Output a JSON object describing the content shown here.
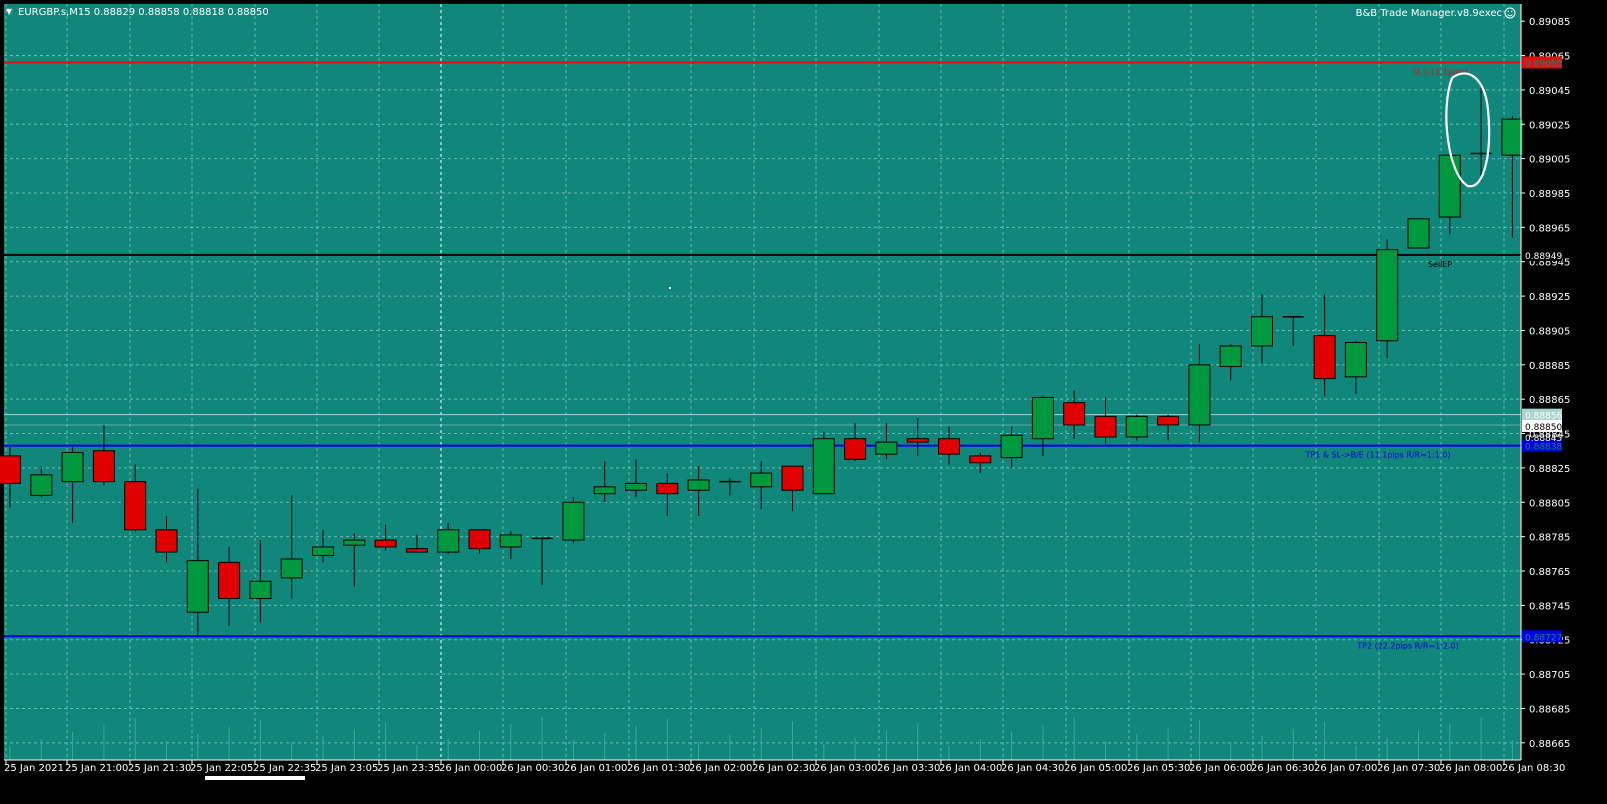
{
  "header": {
    "symbol_line": "EURGBP.s,M15  0.88829 0.88858 0.88818 0.88850",
    "ea_label": "B&B Trade Manager.v8.9exec",
    "ea_icon": "smiley-icon"
  },
  "colors": {
    "background": "#10877A",
    "grid": "#6BB8AE",
    "bull": "#00983E",
    "bear": "#E00000",
    "wick": "#000000",
    "sl_line": "#E01010",
    "entry_line": "#000000",
    "tp_line": "#0000E0",
    "price_line": "#A8D4CE",
    "annotation": "#FFFFFF"
  },
  "chart_data": {
    "type": "candlestick",
    "ylim": [
      0.88655,
      0.89095
    ],
    "y_ticks": [
      "0.89065",
      "0.89045",
      "0.89025",
      "0.89005",
      "0.88985",
      "0.88965",
      "0.88945",
      "0.88925",
      "0.88905",
      "0.88885",
      "0.88865",
      "0.88845",
      "0.88825",
      "0.88805",
      "0.88785",
      "0.88765",
      "0.88745",
      "0.88725",
      "0.88705",
      "0.88685",
      "0.88665"
    ],
    "y_extra_ticks": [
      "0.89085"
    ],
    "x_labels": [
      "25 Jan 2021",
      "25 Jan 21:00",
      "25 Jan 21:30",
      "25 Jan 22:05",
      "25 Jan 22:35",
      "25 Jan 23:05",
      "25 Jan 23:35",
      "26 Jan 00:00",
      "26 Jan 00:30",
      "26 Jan 01:00",
      "26 Jan 01:30",
      "26 Jan 02:00",
      "26 Jan 02:30",
      "26 Jan 03:00",
      "26 Jan 03:30",
      "26 Jan 04:00",
      "26 Jan 04:30",
      "26 Jan 05:00",
      "26 Jan 05:30",
      "26 Jan 06:00",
      "26 Jan 06:30",
      "26 Jan 07:00",
      "26 Jan 07:30",
      "26 Jan 08:00",
      "26 Jan 08:30"
    ],
    "candles": [
      {
        "o": 0.88832,
        "h": 0.88837,
        "l": 0.88802,
        "c": 0.88816
      },
      {
        "o": 0.88809,
        "h": 0.88826,
        "l": 0.88808,
        "c": 0.88821
      },
      {
        "o": 0.88817,
        "h": 0.88837,
        "l": 0.88793,
        "c": 0.88834
      },
      {
        "o": 0.88835,
        "h": 0.8885,
        "l": 0.88815,
        "c": 0.88817
      },
      {
        "o": 0.88817,
        "h": 0.88827,
        "l": 0.88788,
        "c": 0.88789
      },
      {
        "o": 0.88789,
        "h": 0.88797,
        "l": 0.8877,
        "c": 0.88776
      },
      {
        "o": 0.88741,
        "h": 0.88813,
        "l": 0.88728,
        "c": 0.88771
      },
      {
        "o": 0.8877,
        "h": 0.88779,
        "l": 0.88733,
        "c": 0.88749
      },
      {
        "o": 0.88749,
        "h": 0.88783,
        "l": 0.88735,
        "c": 0.88759
      },
      {
        "o": 0.88761,
        "h": 0.88809,
        "l": 0.88749,
        "c": 0.88772
      },
      {
        "o": 0.88774,
        "h": 0.88789,
        "l": 0.8877,
        "c": 0.88779
      },
      {
        "o": 0.8878,
        "h": 0.88787,
        "l": 0.88756,
        "c": 0.88783
      },
      {
        "o": 0.88783,
        "h": 0.88792,
        "l": 0.88777,
        "c": 0.88779
      },
      {
        "o": 0.88778,
        "h": 0.88786,
        "l": 0.88776,
        "c": 0.88776
      },
      {
        "o": 0.88776,
        "h": 0.88793,
        "l": 0.88775,
        "c": 0.88789
      },
      {
        "o": 0.88789,
        "h": 0.88789,
        "l": 0.88775,
        "c": 0.88778
      },
      {
        "o": 0.88779,
        "h": 0.88788,
        "l": 0.88772,
        "c": 0.88786
      },
      {
        "o": 0.88784,
        "h": 0.88784,
        "l": 0.88757,
        "c": 0.88784
      },
      {
        "o": 0.88783,
        "h": 0.88808,
        "l": 0.88781,
        "c": 0.88805
      },
      {
        "o": 0.8881,
        "h": 0.88829,
        "l": 0.88805,
        "c": 0.88814
      },
      {
        "o": 0.88812,
        "h": 0.8883,
        "l": 0.88808,
        "c": 0.88816
      },
      {
        "o": 0.88816,
        "h": 0.88822,
        "l": 0.88797,
        "c": 0.8881
      },
      {
        "o": 0.88812,
        "h": 0.88826,
        "l": 0.88797,
        "c": 0.88818
      },
      {
        "o": 0.88817,
        "h": 0.88819,
        "l": 0.88809,
        "c": 0.88817
      },
      {
        "o": 0.88814,
        "h": 0.88829,
        "l": 0.88801,
        "c": 0.88822
      },
      {
        "o": 0.88826,
        "h": 0.88826,
        "l": 0.888,
        "c": 0.88812
      },
      {
        "o": 0.8881,
        "h": 0.88846,
        "l": 0.8881,
        "c": 0.88842
      },
      {
        "o": 0.88842,
        "h": 0.88851,
        "l": 0.88829,
        "c": 0.8883
      },
      {
        "o": 0.88833,
        "h": 0.88851,
        "l": 0.8883,
        "c": 0.8884
      },
      {
        "o": 0.88842,
        "h": 0.88854,
        "l": 0.88832,
        "c": 0.8884
      },
      {
        "o": 0.88842,
        "h": 0.88849,
        "l": 0.88827,
        "c": 0.88833
      },
      {
        "o": 0.88832,
        "h": 0.88834,
        "l": 0.88822,
        "c": 0.88828
      },
      {
        "o": 0.88831,
        "h": 0.88849,
        "l": 0.88825,
        "c": 0.88844
      },
      {
        "o": 0.88842,
        "h": 0.88867,
        "l": 0.88832,
        "c": 0.88866
      },
      {
        "o": 0.88863,
        "h": 0.8887,
        "l": 0.88842,
        "c": 0.8885
      },
      {
        "o": 0.88855,
        "h": 0.88866,
        "l": 0.88839,
        "c": 0.88843
      },
      {
        "o": 0.88843,
        "h": 0.88856,
        "l": 0.88841,
        "c": 0.88855
      },
      {
        "o": 0.88855,
        "h": 0.88856,
        "l": 0.88841,
        "c": 0.8885
      },
      {
        "o": 0.8885,
        "h": 0.88897,
        "l": 0.8884,
        "c": 0.88885
      },
      {
        "o": 0.88884,
        "h": 0.88897,
        "l": 0.88876,
        "c": 0.88896
      },
      {
        "o": 0.88896,
        "h": 0.88926,
        "l": 0.88886,
        "c": 0.88913
      },
      {
        "o": 0.88913,
        "h": 0.88913,
        "l": 0.88896,
        "c": 0.88913
      },
      {
        "o": 0.88902,
        "h": 0.88926,
        "l": 0.88867,
        "c": 0.88877
      },
      {
        "o": 0.88878,
        "h": 0.88899,
        "l": 0.88868,
        "c": 0.88898
      },
      {
        "o": 0.88899,
        "h": 0.88958,
        "l": 0.88889,
        "c": 0.88952
      },
      {
        "o": 0.88953,
        "h": 0.8897,
        "l": 0.88953,
        "c": 0.8897
      },
      {
        "o": 0.88971,
        "h": 0.89007,
        "l": 0.88961,
        "c": 0.89007
      },
      {
        "o": 0.89008,
        "h": 0.89046,
        "l": 0.88992,
        "c": 0.89008
      },
      {
        "o": 0.89007,
        "h": 0.8903,
        "l": 0.88959,
        "c": 0.89028
      }
    ],
    "levels": [
      {
        "price": 0.89061,
        "tag": "0.89060",
        "label": "SL (-11.1pips)",
        "kind": "sl"
      },
      {
        "price": 0.88949,
        "tag": "0.88949",
        "label": "SellEP",
        "kind": "entry"
      },
      {
        "price": 0.88838,
        "tag": "0.88838",
        "label": "TP1 & SL->B/E (11.1pips R/R=1:1.0)",
        "kind": "tp"
      },
      {
        "price": 0.88727,
        "tag": "0.88727",
        "label": "TP2 (22.2pips R/R=1:2.0)",
        "kind": "tp"
      }
    ],
    "current_price": {
      "value": 0.8885,
      "tag": "0.88850"
    },
    "ask_line": {
      "value": 0.88856,
      "tag": "0.88856"
    },
    "ask_tag_extra": "0.88845",
    "annotation": "circle around candle near 26 Jan 08:00"
  }
}
